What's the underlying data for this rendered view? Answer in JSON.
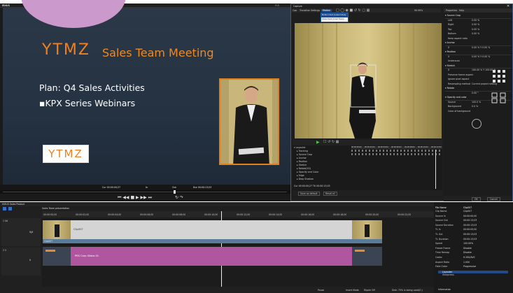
{
  "player": {
    "app_title": "EDIUS",
    "player_label": "PLR",
    "slide": {
      "logo_text": "YTMZ",
      "title": "Sales Team Meeting",
      "plan": "Plan: Q4 Sales Activities",
      "bullet": "▪KPX Series Webinars",
      "bottom_logo": "YTMZ"
    },
    "tc_in": "Cur 00:00:00;27",
    "tc_in2": "In",
    "tc_out": "Out",
    "tc_dur": "Dur 00:00:13;03",
    "tc_out_val": "Ttl 00:00:13;03"
  },
  "capture": {
    "title": "Capture",
    "menu": [
      "Cap",
      "Transition",
      "Settings",
      "Motion"
    ],
    "dropdown": [
      "Motion track (Lower trace)",
      "Close track (Inner trace)"
    ],
    "zoom": "99.99%",
    "props_tabs": [
      "Properties",
      "Help"
    ],
    "props": [
      {
        "section": "Source Crop"
      },
      {
        "label": "Left",
        "value": "0.00 %"
      },
      {
        "label": "Right",
        "value": "0.00 %"
      },
      {
        "label": "Top",
        "value": "0.00 %"
      },
      {
        "label": "Bottom",
        "value": "0.00 %"
      },
      {
        "label": "Keep aspect ratio",
        "value": ""
      },
      {
        "section": "Anchor"
      },
      {
        "label": "X",
        "value": "0.00 %   Y  0.00 %"
      },
      {
        "section": "Position"
      },
      {
        "label": "X",
        "value": "0.00 %   Y  0.00 %"
      },
      {
        "label": "Underscan",
        "value": ""
      },
      {
        "section": "Stretch"
      },
      {
        "label": "X",
        "value": "100.00 %   Y  100.00 %"
      },
      {
        "label": "Preserve frame aspect",
        "value": ""
      },
      {
        "label": "Ignore pixel aspect",
        "value": ""
      },
      {
        "label": "Resampling method",
        "value": "Current project setting"
      },
      {
        "section": "Rotate"
      },
      {
        "label": "",
        "value": "0.00 °"
      },
      {
        "section": "Opacity and color"
      },
      {
        "label": "Source",
        "value": "100.0 %"
      },
      {
        "label": "Background",
        "value": "0.0 %"
      },
      {
        "label": "Color of background",
        "value": ""
      }
    ],
    "layers": [
      "Layouter",
      "Tracking",
      "Source Crop",
      "Anchor",
      "Position",
      "Stretch",
      "Rotate(2D)",
      "Opacity and Color",
      "Edge",
      "Drop Shadow"
    ],
    "tl_times": [
      "00:00:00;00",
      "00:00:02;00",
      "00:00:04;00",
      "00:00:06;00",
      "00:00:08;00",
      "00:00:10;00",
      "00:00:12;00"
    ],
    "cur_time": "Cur 00:00:00;27  Ttl 00:00:13;03",
    "btn_save": "Save as default",
    "btn_reset": "Reset all",
    "btn_ok": "OK",
    "btn_cancel": "Cancel"
  },
  "timeline": {
    "title": "EDIUS  Sales Product",
    "seq_name": "Sales Team presentation",
    "ruler": [
      "00:00:00;00",
      "00:00:02;00",
      "00:00:04;00",
      "00:00:06;00",
      "00:00:08;00",
      "00:00:10;00",
      "00:00:12;00",
      "00:00:14;00",
      "00:00:16;00",
      "00:00:18;00",
      "00:00:20;00",
      "00:00:22;00"
    ],
    "tracks": [
      {
        "name": "1 VA",
        "sub": "V|A",
        "clip": "Clip007",
        "sub_clip": "Clip007"
      },
      {
        "name": "2 V",
        "sub": "V",
        "clip": "PRS Corp Slides 01",
        "sub_clip": ""
      }
    ],
    "status": [
      "Pause",
      "Insert Mode",
      "Ripple Off",
      "Disk: 75% is being used(E:)"
    ]
  },
  "info": {
    "header_name": "File Name",
    "header_value": "Clip007",
    "rows": [
      [
        "Clip Name",
        "Clip007"
      ],
      [
        "Source In",
        "00:00:00;00"
      ],
      [
        "Source Out",
        "00:00:13;03"
      ],
      [
        "Source Duration",
        "00:00:13;03"
      ],
      [
        "TL In",
        "00:00:00;00"
      ],
      [
        "TL Out",
        "00:00:13;03"
      ],
      [
        "TL Duration",
        "00:00:13;03"
      ],
      [
        "Speed",
        "100.00%"
      ],
      [
        "Freeze Frame",
        "Disable"
      ],
      [
        "Time Remap",
        "Disable"
      ],
      [
        "Codec",
        "H.264/AVC"
      ],
      [
        "Aspect Ratio",
        "1.000"
      ],
      [
        "Field Order",
        "Progressive"
      ]
    ],
    "effects": [
      "Layouter",
      "Sharpness"
    ],
    "info_label": "Information"
  }
}
